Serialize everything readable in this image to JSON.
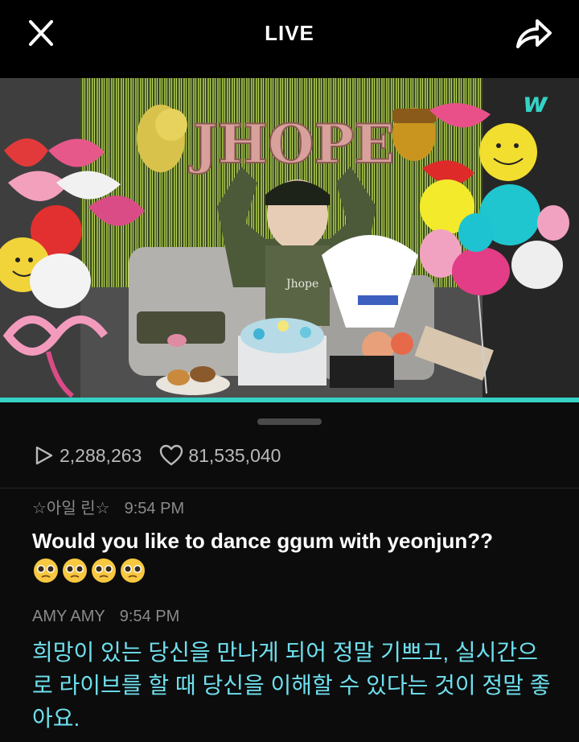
{
  "header": {
    "title": "LIVE",
    "close_icon": "close-icon",
    "share_icon": "share-icon"
  },
  "video": {
    "banner_text": "JHOPE",
    "patch_text": "Jhope",
    "watermark": "w",
    "progress_fraction": 1.0,
    "accent_color": "#35d2c6"
  },
  "stats": {
    "plays_icon": "play-outline-icon",
    "plays": "2,288,263",
    "likes_icon": "heart-outline-icon",
    "likes": "81,535,040"
  },
  "comments": [
    {
      "author": "☆아일 린☆",
      "time": "9:54 PM",
      "text": "Would you like to dance ggum with yeonjun??",
      "emoji_count": 4,
      "emoji_icon": "pleading-face-emoji"
    },
    {
      "author": "AMY AMY",
      "time": "9:54 PM",
      "text": "희망이 있는 당신을 만나게 되어 정말 기쁘고, 실시간으로 라이브를 할 때 당신을 이해할 수 있다는 것이 정말 좋아요.",
      "text_color": "#6fe0ee"
    }
  ]
}
